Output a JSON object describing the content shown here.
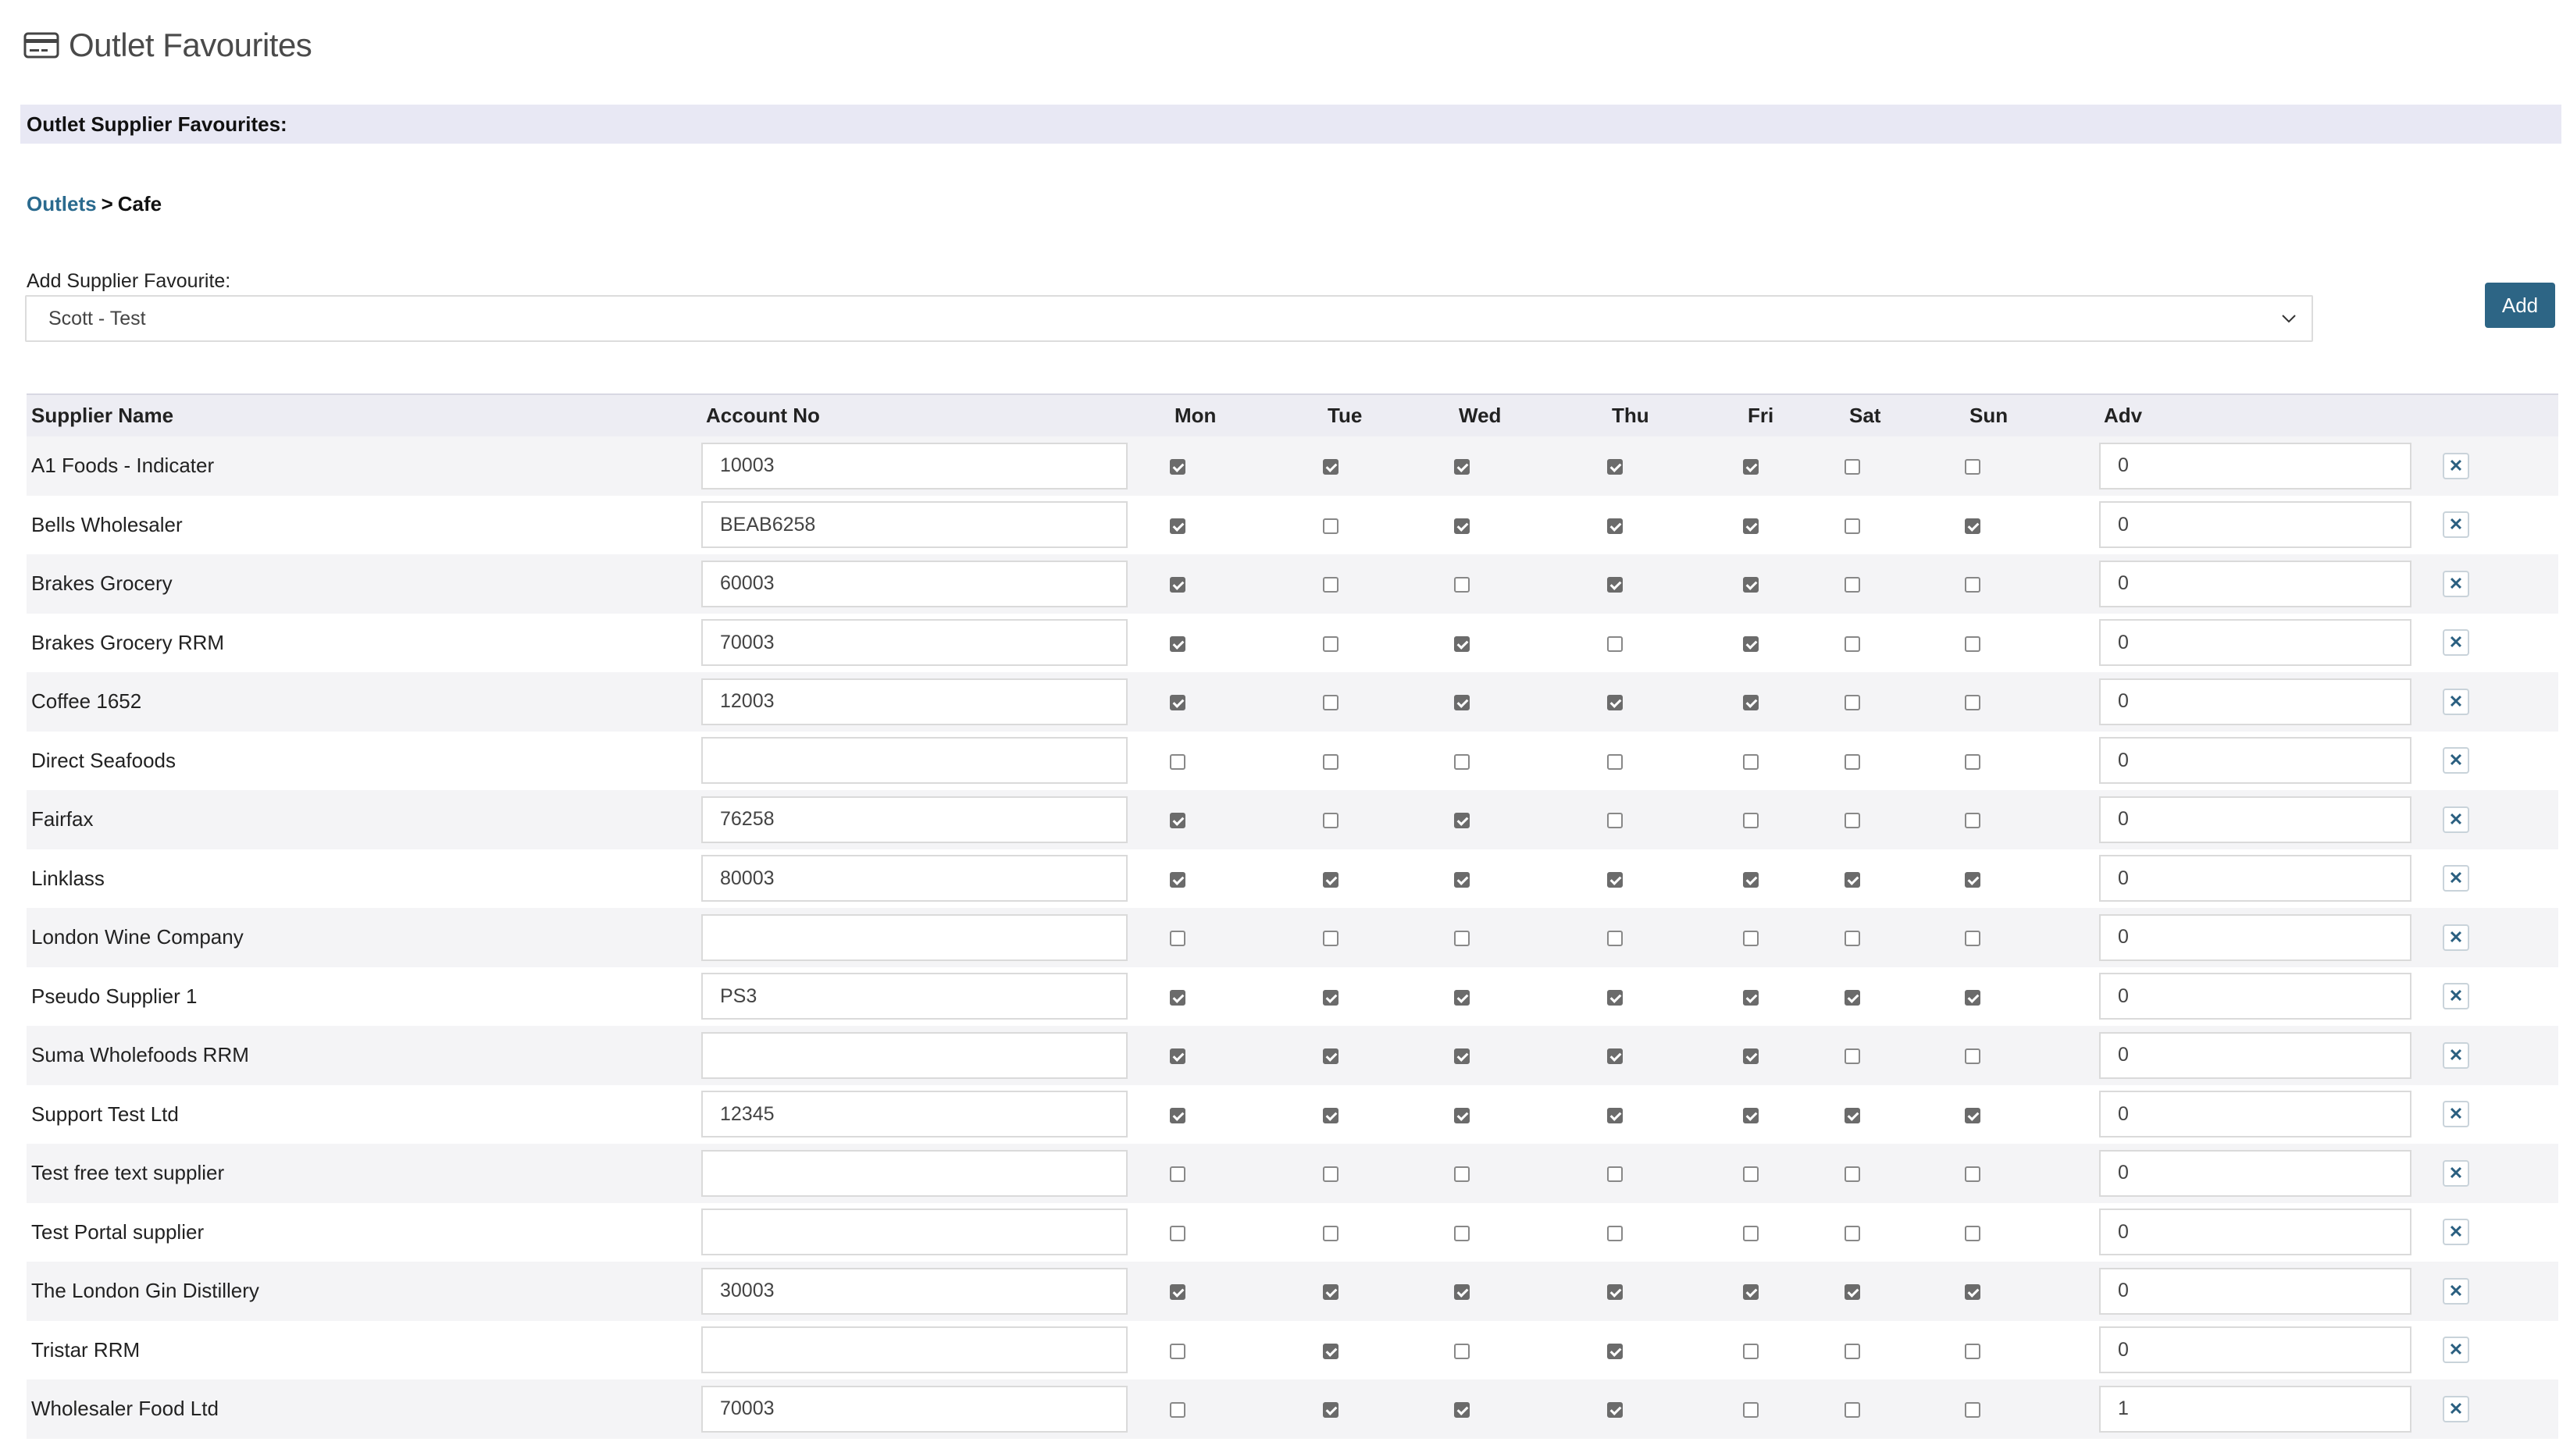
{
  "page": {
    "title": "Outlet Favourites",
    "title_icon": "credit-card-icon"
  },
  "section": {
    "title": "Outlet Supplier Favourites:"
  },
  "breadcrumb": {
    "link": "Outlets",
    "separator": ">",
    "current": "Cafe"
  },
  "add_favourite": {
    "label": "Add Supplier Favourite:",
    "selected": "Scott - Test",
    "button_label": "Add"
  },
  "table": {
    "headers": [
      "Supplier Name",
      "Account No",
      "Mon",
      "Tue",
      "Wed",
      "Thu",
      "Fri",
      "Sat",
      "Sun",
      "Adv"
    ],
    "rows": [
      {
        "name": "A1 Foods - Indicater",
        "account": "10003",
        "days": [
          1,
          1,
          1,
          1,
          1,
          0,
          0
        ],
        "adv": "0"
      },
      {
        "name": "Bells Wholesaler",
        "account": "BEAB6258",
        "days": [
          1,
          0,
          1,
          1,
          1,
          0,
          1
        ],
        "adv": "0"
      },
      {
        "name": "Brakes Grocery",
        "account": "60003",
        "days": [
          1,
          0,
          0,
          1,
          1,
          0,
          0
        ],
        "adv": "0"
      },
      {
        "name": "Brakes Grocery RRM",
        "account": "70003",
        "days": [
          1,
          0,
          1,
          0,
          1,
          0,
          0
        ],
        "adv": "0"
      },
      {
        "name": "Coffee 1652",
        "account": "12003",
        "days": [
          1,
          0,
          1,
          1,
          1,
          0,
          0
        ],
        "adv": "0"
      },
      {
        "name": "Direct Seafoods",
        "account": "",
        "days": [
          0,
          0,
          0,
          0,
          0,
          0,
          0
        ],
        "adv": "0"
      },
      {
        "name": "Fairfax",
        "account": "76258",
        "days": [
          1,
          0,
          1,
          0,
          0,
          0,
          0
        ],
        "adv": "0"
      },
      {
        "name": "Linklass",
        "account": "80003",
        "days": [
          1,
          1,
          1,
          1,
          1,
          1,
          1
        ],
        "adv": "0"
      },
      {
        "name": "London Wine Company",
        "account": "",
        "days": [
          0,
          0,
          0,
          0,
          0,
          0,
          0
        ],
        "adv": "0"
      },
      {
        "name": "Pseudo Supplier 1",
        "account": "PS3",
        "days": [
          1,
          1,
          1,
          1,
          1,
          1,
          1
        ],
        "adv": "0"
      },
      {
        "name": "Suma Wholefoods RRM",
        "account": "",
        "days": [
          1,
          1,
          1,
          1,
          1,
          0,
          0
        ],
        "adv": "0"
      },
      {
        "name": "Support Test Ltd",
        "account": "12345",
        "days": [
          1,
          1,
          1,
          1,
          1,
          1,
          1
        ],
        "adv": "0"
      },
      {
        "name": "Test free text supplier",
        "account": "",
        "days": [
          0,
          0,
          0,
          0,
          0,
          0,
          0
        ],
        "adv": "0"
      },
      {
        "name": "Test Portal supplier",
        "account": "",
        "days": [
          0,
          0,
          0,
          0,
          0,
          0,
          0
        ],
        "adv": "0"
      },
      {
        "name": "The London Gin Distillery",
        "account": "30003",
        "days": [
          1,
          1,
          1,
          1,
          1,
          1,
          1
        ],
        "adv": "0"
      },
      {
        "name": "Tristar RRM",
        "account": "",
        "days": [
          0,
          1,
          0,
          1,
          0,
          0,
          0
        ],
        "adv": "0"
      },
      {
        "name": "Wholesaler Food Ltd",
        "account": "70003",
        "days": [
          0,
          1,
          1,
          1,
          0,
          0,
          0
        ],
        "adv": "1"
      }
    ],
    "delete_icon": "close-icon"
  }
}
